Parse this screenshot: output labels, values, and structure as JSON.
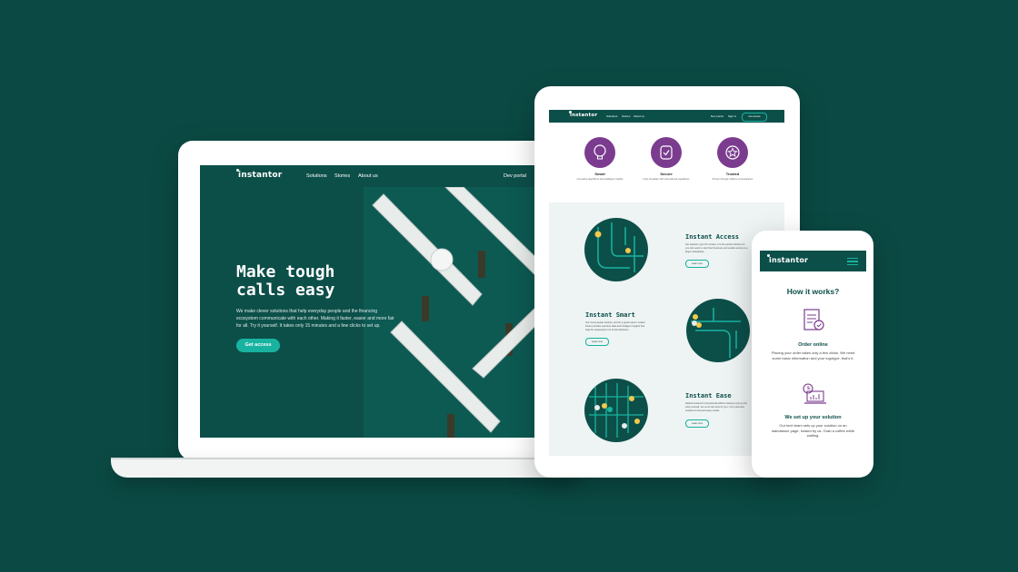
{
  "brand": {
    "logo_text": "instantor"
  },
  "colors": {
    "background": "#0b4a44",
    "brand_teal": "#0c4f49",
    "accent": "#18b3a0",
    "purple": "#7b3c8f",
    "yellow": "#f2c94c"
  },
  "laptop": {
    "nav": {
      "items": [
        "Solutions",
        "Stories",
        "About us"
      ],
      "right": "Dev portal"
    },
    "hero": {
      "title_line1": "Make tough",
      "title_line2": "calls easy",
      "text": "We make clever solutions that help everyday people and the financing ecosystem communicate with each other. Making it faster, easier and more fair for all. Try it yourself. It takes only 15 minutes and a few clicks to set up.",
      "cta": "Get access"
    }
  },
  "tablet": {
    "nav": {
      "items": [
        "Solutions",
        "Stories",
        "About us"
      ],
      "dev": "Dev portal",
      "signin": "Sign in",
      "button": "Get access"
    },
    "features": [
      {
        "title": "Smart",
        "desc": "Innovative algorithms and intelligent insights"
      },
      {
        "title": "Secure",
        "desc": "Fully compliant with international regulations"
      },
      {
        "title": "Trusted",
        "desc": "Proven through millions of transactions"
      }
    ],
    "sections": [
      {
        "title": "Instant Access",
        "text": "Get started in just 15 minutes. It is the perfect solution for you who want to start their business and enable access to a large marketplace.",
        "link": "Learn more"
      },
      {
        "title": "Instant Smart",
        "text": "Our most popular solution, and for a good reason. Instant Score provides real-time data and intelligent insights that help the assessment out of risk decisions.",
        "link": "Learn more"
      },
      {
        "title": "Instant Ease",
        "text": "Default Instantor's full potential without having to put up the work yourself. Let us do the work for you. It is a premium solution for fast and easy results.",
        "link": "Learn more"
      }
    ]
  },
  "phone": {
    "title": "How it works?",
    "steps": [
      {
        "title": "Order online",
        "text": "Placing your order takes only a few clicks. We need some basic information and your logotype, that's it."
      },
      {
        "title": "We set up your solution",
        "text": "Our tech team sets up your solution on an standalone page, hosted by us. Grab a coffee while waiting."
      }
    ]
  }
}
